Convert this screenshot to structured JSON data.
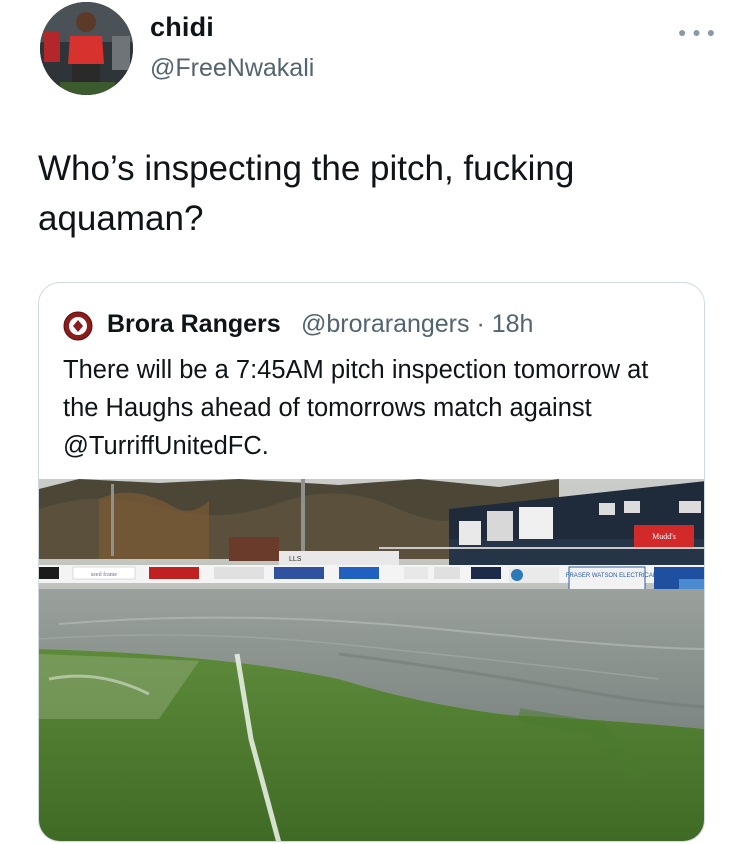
{
  "tweet": {
    "display_name": "chidi",
    "handle": "@FreeNwakali",
    "more_icon": "ellipsis-icon",
    "text": "Who’s inspecting the pitch, fucking aquaman?"
  },
  "quoted_tweet": {
    "display_name": "Brora Rangers",
    "handle": "@brorarangers",
    "separator": "·",
    "time": "18h",
    "text": "There will be a 7:45AM pitch inspection tomorrow at the Haughs ahead of tomorrows match against @TurriffUnitedFC.",
    "photo": {
      "signs": {
        "board_1": "seed frame",
        "board_2": "Mudd's",
        "board_3": "FRASER WATSON ELECTRICAL",
        "board_4": "LLS"
      }
    }
  },
  "colors": {
    "text": "#0f1419",
    "secondary": "#536471",
    "border": "#cfd9de",
    "grass": "#4f7a2e",
    "water": "#8e9794"
  }
}
